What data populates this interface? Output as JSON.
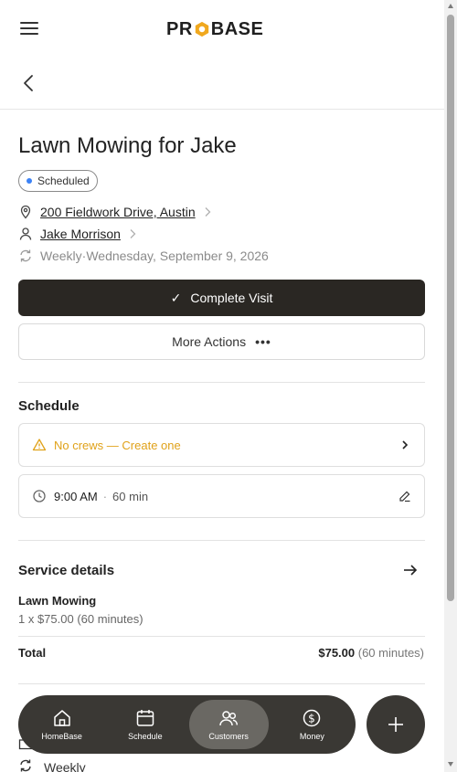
{
  "brand": {
    "logo_left": "PR",
    "logo_right": "BASE",
    "accent": "#f0a81e"
  },
  "visit": {
    "title": "Lawn Mowing for Jake",
    "status": "Scheduled",
    "address": "200 Fieldwork Drive, Austin",
    "customer": "Jake Morrison",
    "recurrence": "Weekly",
    "recurrence_sep": " · ",
    "date": "Wednesday, September 9, 2026"
  },
  "actions": {
    "complete_label": "Complete Visit",
    "more_label": "More Actions",
    "more_dots": "•••"
  },
  "schedule": {
    "title": "Schedule",
    "crew_warning": "No crews — Create one",
    "time": "9:00 AM",
    "time_sep": "·",
    "duration": "60 min"
  },
  "service_details": {
    "title": "Service details",
    "item_name": "Lawn Mowing",
    "item_line": "1 x $75.00 (60 minutes)",
    "total_label": "Total",
    "total_amount": "$75.00",
    "total_note": "(60 minutes)"
  },
  "peek": {
    "recurrence_label": "Weekly"
  },
  "nav": {
    "items": [
      {
        "label": "HomeBase"
      },
      {
        "label": "Schedule"
      },
      {
        "label": "Customers"
      },
      {
        "label": "Money"
      }
    ]
  }
}
